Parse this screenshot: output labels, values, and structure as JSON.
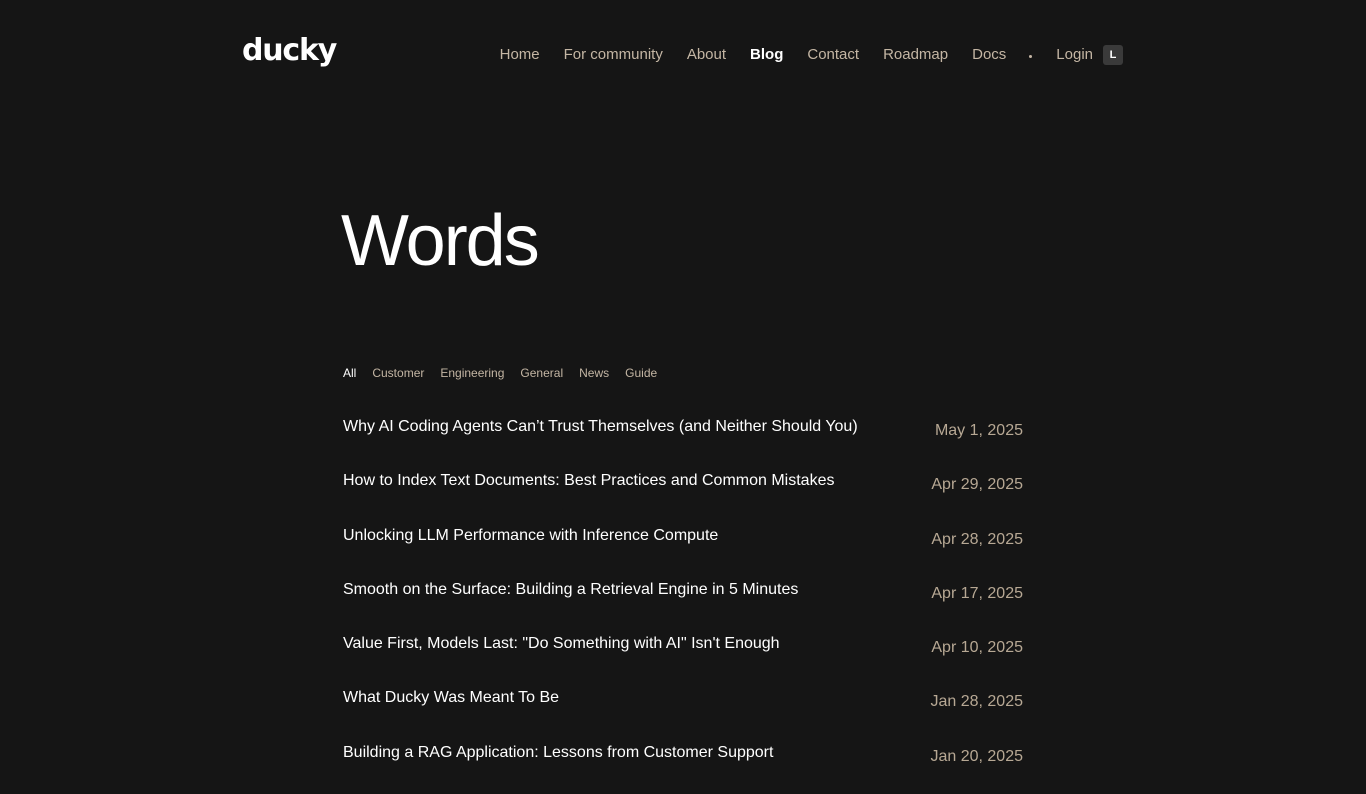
{
  "header": {
    "logo": "ducky",
    "nav": [
      {
        "label": "Home",
        "active": false
      },
      {
        "label": "For community",
        "active": false
      },
      {
        "label": "About",
        "active": false
      },
      {
        "label": "Blog",
        "active": true
      },
      {
        "label": "Contact",
        "active": false
      },
      {
        "label": "Roadmap",
        "active": false
      },
      {
        "label": "Docs",
        "active": false
      }
    ],
    "login": {
      "label": "Login",
      "shortcut": "L"
    }
  },
  "main": {
    "title": "Words",
    "filters": [
      {
        "label": "All",
        "active": true
      },
      {
        "label": "Customer",
        "active": false
      },
      {
        "label": "Engineering",
        "active": false
      },
      {
        "label": "General",
        "active": false
      },
      {
        "label": "News",
        "active": false
      },
      {
        "label": "Guide",
        "active": false
      }
    ],
    "posts": [
      {
        "title": "Why AI Coding Agents Can’t Trust Themselves (and Neither Should You)",
        "date": "May 1, 2025"
      },
      {
        "title": "How to Index Text Documents: Best Practices and Common Mistakes",
        "date": "Apr 29, 2025"
      },
      {
        "title": "Unlocking LLM Performance with Inference Compute",
        "date": "Apr 28, 2025"
      },
      {
        "title": "Smooth on the Surface: Building a Retrieval Engine in 5 Minutes",
        "date": "Apr 17, 2025"
      },
      {
        "title": "Value First, Models Last: \"Do Something with AI\" Isn't Enough",
        "date": "Apr 10, 2025"
      },
      {
        "title": "What Ducky Was Meant To Be",
        "date": "Jan 28, 2025"
      },
      {
        "title": "Building a RAG Application: Lessons from Customer Support",
        "date": "Jan 20, 2025"
      }
    ]
  },
  "colors": {
    "background": "#151515",
    "text": "#ffffff",
    "muted": "#c4b6a4",
    "date": "#b7a894"
  }
}
